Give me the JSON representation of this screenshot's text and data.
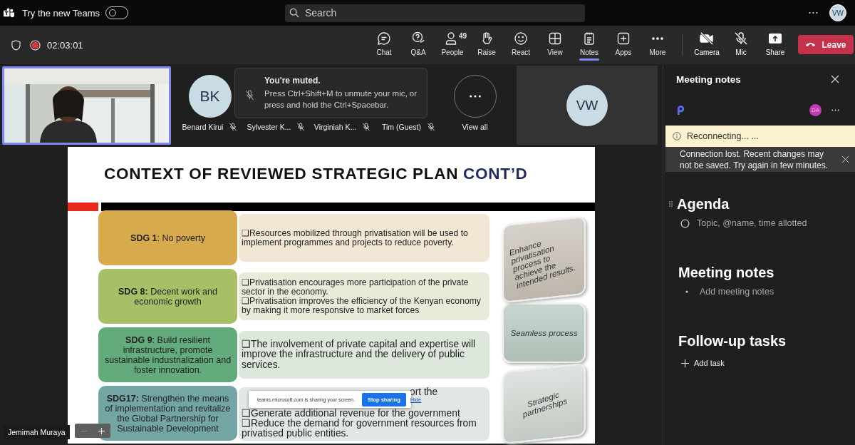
{
  "top_bar": {
    "new_teams_label": "Try the new Teams",
    "new_teams_toggle": {
      "on": false
    },
    "search": {
      "placeholder": "Search"
    },
    "account": {
      "initials": "VW"
    }
  },
  "meeting_bar": {
    "recording": true,
    "elapsed": "02:03:01",
    "tools": [
      {
        "kind": "chat",
        "label": "Chat",
        "selected": false
      },
      {
        "kind": "qa",
        "label": "Q&A",
        "selected": false
      },
      {
        "kind": "people",
        "label": "People",
        "badge": "49",
        "selected": false
      },
      {
        "kind": "raise",
        "label": "Raise",
        "selected": false
      },
      {
        "kind": "react",
        "label": "React",
        "selected": false
      },
      {
        "kind": "view",
        "label": "View",
        "selected": false
      },
      {
        "kind": "notes",
        "label": "Notes",
        "selected": true
      },
      {
        "kind": "apps",
        "label": "Apps",
        "selected": false
      },
      {
        "kind": "more",
        "label": "More",
        "selected": false
      }
    ],
    "devices": [
      {
        "kind": "camera",
        "label": "Camera",
        "on": false
      },
      {
        "kind": "mic",
        "label": "Mic",
        "on": false
      }
    ],
    "share": {
      "label": "Share"
    },
    "leave": {
      "label": "Leave"
    }
  },
  "participants": [
    {
      "name": "Benard Kirui",
      "initials": "BK",
      "muted": true
    },
    {
      "name": "Sylvester K...",
      "muted": true
    },
    {
      "name": "Virginiah K...",
      "muted": true
    },
    {
      "name": "Tim (Guest)",
      "muted": true
    }
  ],
  "view_all": {
    "label": "View all"
  },
  "self_tile": {
    "initials": "VW"
  },
  "muted_toast": {
    "title": "You're muted.",
    "body": "Press Ctrl+Shift+M to unmute your mic, or press and hold the Ctrl+Spacebar."
  },
  "presenter": {
    "name": "Jemimah Muraya"
  },
  "slide": {
    "title": "CONTEXT OF REVIEWED STRATEGIC PLAN",
    "title_accent": "CONT’D",
    "rows": [
      {
        "color": "#d8aa4e",
        "large": false,
        "goal": "**SDG 1**: No poverty",
        "bullets": [
          {
            "kind": "full",
            "text": "❑Resources mobilized through privatisation will be used to implement programmes and projects to reduce poverty."
          }
        ]
      },
      {
        "color": "#a7c067",
        "large": false,
        "goal": "**SDG 8:** Decent work and economic growth",
        "bullets": [
          {
            "kind": "full",
            "text": "❑Privatisation encourages more participation of the private sector in the economy."
          },
          {
            "kind": "full",
            "text": "❑Privatisation improves the efficiency of the Kenyan economy by making it more responsive to market forces"
          }
        ]
      },
      {
        "color": "#63ab7c",
        "large": true,
        "goal": "**SDG 9**: Build resilient infrastructure, promote sustainable industrialization and foster innovation.",
        "bullets": [
          {
            "kind": "full",
            "text": "❑The involvement of private capital and expertise will improve the infrastructure and the delivery of public services."
          }
        ]
      },
      {
        "color": "#72a5a3",
        "large": true,
        "goal": "**SDG17:** Strengthen the means of implementation and revitalize the Global Partnership for Sustainable Development",
        "bullets": [
          {
            "kind": "covered",
            "text": "ort the"
          },
          {
            "kind": "full",
            "text": "❑Generate additional revenue for the government"
          },
          {
            "kind": "full",
            "text": "❑Reduce the demand for government resources from privatised public entities."
          }
        ]
      }
    ],
    "pillars": [
      {
        "label": "Enhance privatisation process to achieve the intended results.",
        "tilt": true
      },
      {
        "label": "Seamless process",
        "tilt": false
      },
      {
        "label": "Strategic partnerships",
        "tilt": true
      }
    ]
  },
  "share_bar": {
    "message": "teams.microsoft.com is sharing your screen.",
    "stop": "Stop sharing",
    "hide": "Hide"
  },
  "notes_panel": {
    "title": "Meeting notes",
    "collaborator": {
      "initials": "DA"
    },
    "status": "Reconnecting...  ...",
    "error": "Connection lost. Recent changes may not be saved. Try again in few minutes.",
    "sections": [
      {
        "kind": "agenda",
        "heading": "Agenda",
        "placeholder": "Topic, @name, time allotted"
      },
      {
        "kind": "notes",
        "heading": "Meeting notes",
        "placeholder": "Add meeting notes"
      },
      {
        "kind": "tasks",
        "heading": "Follow-up tasks",
        "placeholder": "Add task"
      }
    ]
  }
}
